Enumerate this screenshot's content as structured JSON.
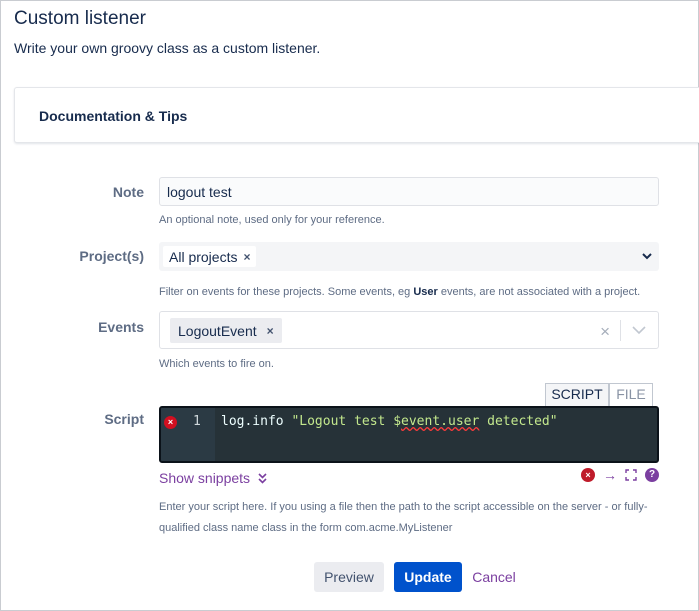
{
  "page": {
    "title": "Custom listener",
    "subtitle": "Write your own groovy class as a custom listener."
  },
  "documentation": {
    "title": "Documentation & Tips"
  },
  "note": {
    "label": "Note",
    "value": "logout test",
    "help": "An optional note, used only for your reference."
  },
  "projects": {
    "label": "Project(s)",
    "selected": "All projects",
    "help_before": "Filter on events for these projects. Some events, eg",
    "help_bold": "User",
    "help_after": "events, are not associated with a project."
  },
  "events": {
    "label": "Events",
    "selected": "LogoutEvent",
    "help": "Which events to fire on."
  },
  "script": {
    "label": "Script",
    "tabs": {
      "script": "SCRIPT",
      "file": "FILE"
    },
    "line_number": "1",
    "code_plain": "log.info ",
    "code_str_before": "\"Logout test $",
    "code_str_squiggle": "event.user",
    "code_str_after": " detected\"",
    "show_snippets": "Show snippets",
    "help": "Enter your script here. If you using a file then the path to the script accessible on the server - or fully-qualified class name class in the form com.acme.MyListener"
  },
  "buttons": {
    "preview": "Preview",
    "update": "Update",
    "cancel": "Cancel"
  },
  "icons": {
    "remove": "×",
    "error": "×",
    "arrow": "→",
    "help": "?"
  },
  "colors": {
    "primary": "#0052cc",
    "link": "#7b3fa0",
    "error": "#bf1b2a",
    "editor_bg": "#263238",
    "string": "#c3e88d"
  }
}
